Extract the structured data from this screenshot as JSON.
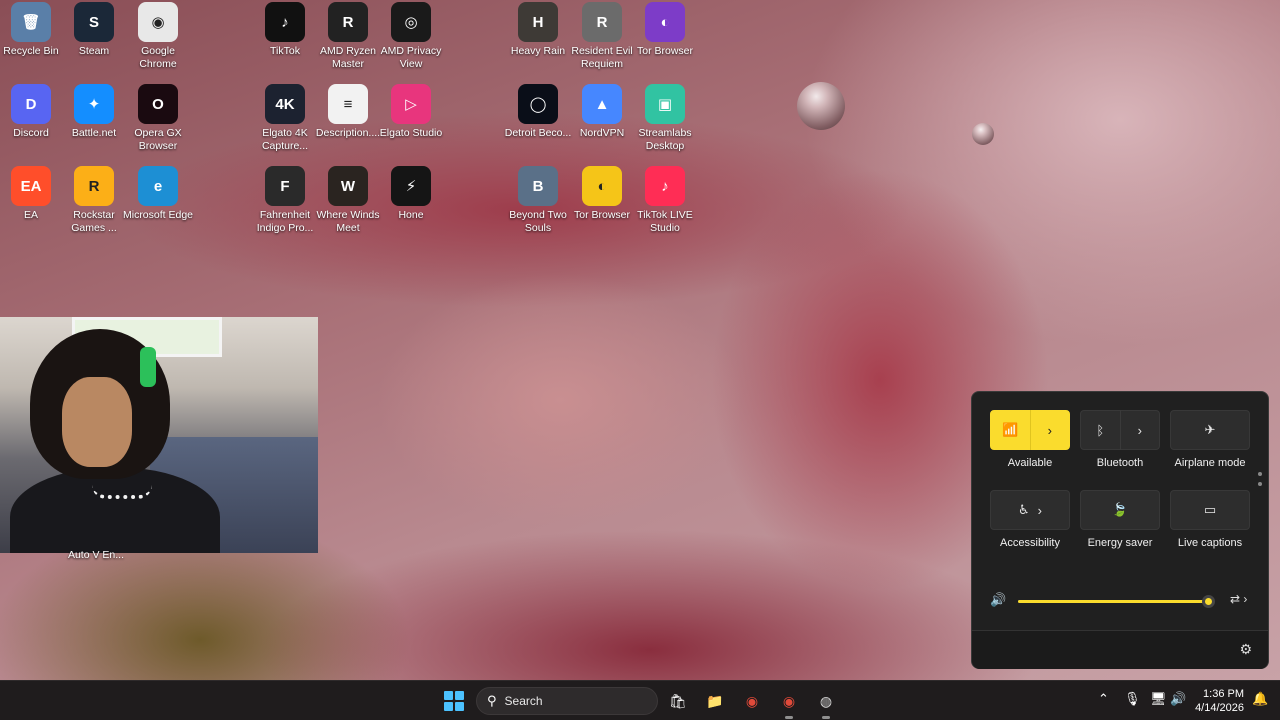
{
  "desktop_icons": [
    {
      "label": "Recycle Bin",
      "color": "#5a7fa8",
      "glyph": "🗑"
    },
    {
      "label": "Steam",
      "color": "#1b2838",
      "glyph": "S"
    },
    {
      "label": "Google Chrome",
      "color": "#e8e8e8",
      "glyph": "◉"
    },
    {
      "label": "TikTok",
      "color": "#111111",
      "glyph": "♪"
    },
    {
      "label": "AMD Ryzen Master",
      "color": "#222222",
      "glyph": "R"
    },
    {
      "label": "AMD Privacy View",
      "color": "#1a1a1a",
      "glyph": "◎"
    },
    {
      "label": "Heavy Rain",
      "color": "#3e3a36",
      "glyph": "H"
    },
    {
      "label": "Resident Evil Requiem",
      "color": "#6b6b6b",
      "glyph": "R"
    },
    {
      "label": "Tor Browser",
      "color": "#7d3cc8",
      "glyph": "◐"
    },
    {
      "label": "Discord",
      "color": "#5865f2",
      "glyph": "D"
    },
    {
      "label": "Battle.net",
      "color": "#148eff",
      "glyph": "✦"
    },
    {
      "label": "Opera GX Browser",
      "color": "#1a0a10",
      "glyph": "O"
    },
    {
      "label": "Elgato 4K Capture...",
      "color": "#1c2230",
      "glyph": "4K"
    },
    {
      "label": "Description....",
      "color": "#f2f2f2",
      "glyph": "≡"
    },
    {
      "label": "Elgato Studio",
      "color": "#e8357d",
      "glyph": "▷"
    },
    {
      "label": "Detroit Beco...",
      "color": "#0a0e18",
      "glyph": "◯"
    },
    {
      "label": "NordVPN",
      "color": "#4687ff",
      "glyph": "▲"
    },
    {
      "label": "Streamlabs Desktop",
      "color": "#31c3a2",
      "glyph": "▣"
    },
    {
      "label": "EA",
      "color": "#ff4e2a",
      "glyph": "EA"
    },
    {
      "label": "Rockstar Games ...",
      "color": "#fcaf17",
      "glyph": "R"
    },
    {
      "label": "Microsoft Edge",
      "color": "#1d8fd4",
      "glyph": "e"
    },
    {
      "label": "Fahrenheit Indigo Pro...",
      "color": "#2a2a2a",
      "glyph": "F"
    },
    {
      "label": "Where Winds Meet",
      "color": "#2a2420",
      "glyph": "W"
    },
    {
      "label": "Hone",
      "color": "#151515",
      "glyph": "⚡"
    },
    {
      "label": "Beyond Two Souls",
      "color": "#5a7088",
      "glyph": "B"
    },
    {
      "label": "Tor Browser",
      "color": "#f5c518",
      "glyph": "◐"
    },
    {
      "label": "TikTok LIVE Studio",
      "color": "#ff2d55",
      "glyph": "♪"
    }
  ],
  "under_webcam_label": "Auto V En...",
  "quick_settings": {
    "tiles": [
      {
        "label": "Available",
        "icon": "wifi-icon",
        "glyph": "📶",
        "active": true,
        "split": true
      },
      {
        "label": "Bluetooth",
        "icon": "bluetooth-icon",
        "glyph": "ᛒ",
        "active": false,
        "split": true
      },
      {
        "label": "Airplane mode",
        "icon": "airplane-icon",
        "glyph": "✈",
        "active": false,
        "split": false
      },
      {
        "label": "Accessibility",
        "icon": "accessibility-icon",
        "glyph": "♿",
        "active": false,
        "split": false,
        "chevron": true
      },
      {
        "label": "Energy saver",
        "icon": "energy-saver-icon",
        "glyph": "🍃",
        "active": false,
        "split": false
      },
      {
        "label": "Live captions",
        "icon": "live-captions-icon",
        "glyph": "▭",
        "active": false,
        "split": false
      }
    ],
    "chevron": "›",
    "volume_level": 0.97,
    "volume_icon": "🔊",
    "volume_output_glyph": "⇄ ›",
    "settings_glyph": "⚙"
  },
  "taskbar": {
    "search_placeholder": "Search",
    "search_glyph": "⚲",
    "apps": [
      {
        "name": "store-app",
        "glyph": "🛍",
        "color": "#ffffff",
        "running": false
      },
      {
        "name": "file-explorer-app",
        "glyph": "📁",
        "color": "#f5c542",
        "running": false
      },
      {
        "name": "chrome-app",
        "glyph": "◉",
        "color": "#e04a3a",
        "running": false
      },
      {
        "name": "chrome-profile-app",
        "glyph": "◉",
        "color": "#e04a3a",
        "running": true
      },
      {
        "name": "obs-app",
        "glyph": "◍",
        "color": "#d8d8d8",
        "running": true
      }
    ],
    "tray": {
      "chevron": "⌃",
      "mic": "🎙",
      "network": "🖥",
      "volume": "🔊"
    },
    "time": "1:36 PM",
    "date": "4/14/2026",
    "notification_glyph": "🔔"
  }
}
